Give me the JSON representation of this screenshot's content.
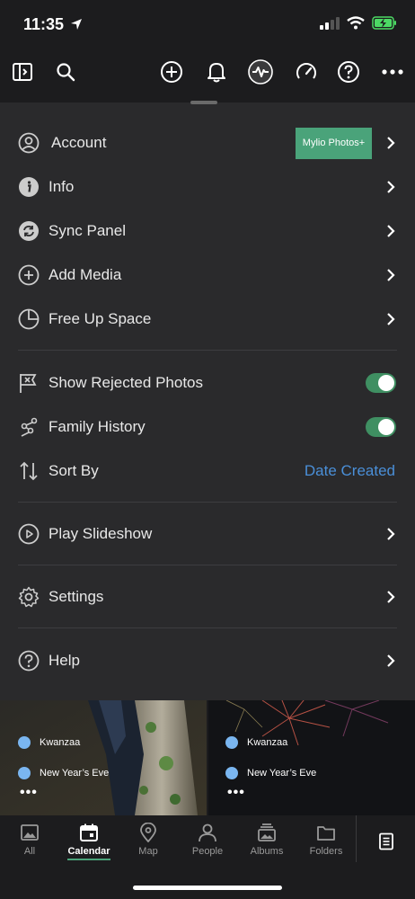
{
  "status": {
    "time": "11:35"
  },
  "toolbar": {
    "icons": [
      "sidebar-toggle-icon",
      "search-icon",
      "add-icon",
      "bell-icon",
      "activity-icon",
      "speedometer-icon",
      "help-icon",
      "more-icon"
    ]
  },
  "menu": {
    "account_label": "Account",
    "account_badge": "Mylio Photos+",
    "info_label": "Info",
    "sync_label": "Sync Panel",
    "add_media_label": "Add Media",
    "free_up_label": "Free Up Space",
    "show_rejected_label": "Show Rejected Photos",
    "show_rejected_on": true,
    "family_history_label": "Family History",
    "family_history_on": true,
    "sort_by_label": "Sort By",
    "sort_by_value": "Date Created",
    "slideshow_label": "Play Slideshow",
    "settings_label": "Settings",
    "help_label": "Help"
  },
  "photos": {
    "left": {
      "event1": "Kwanzaa",
      "event2": "New Year’s Eve"
    },
    "right": {
      "event1": "Kwanzaa",
      "event2": "New Year’s Eve"
    },
    "ellipsis": "•••"
  },
  "tabs": {
    "all": "All",
    "calendar": "Calendar",
    "map": "Map",
    "people": "People",
    "albums": "Albums",
    "folders": "Folders"
  },
  "colors": {
    "accent": "#4aa37a",
    "link": "#4a8fd8",
    "panel": "#2a2a2c",
    "background": "#1c1c1e"
  }
}
